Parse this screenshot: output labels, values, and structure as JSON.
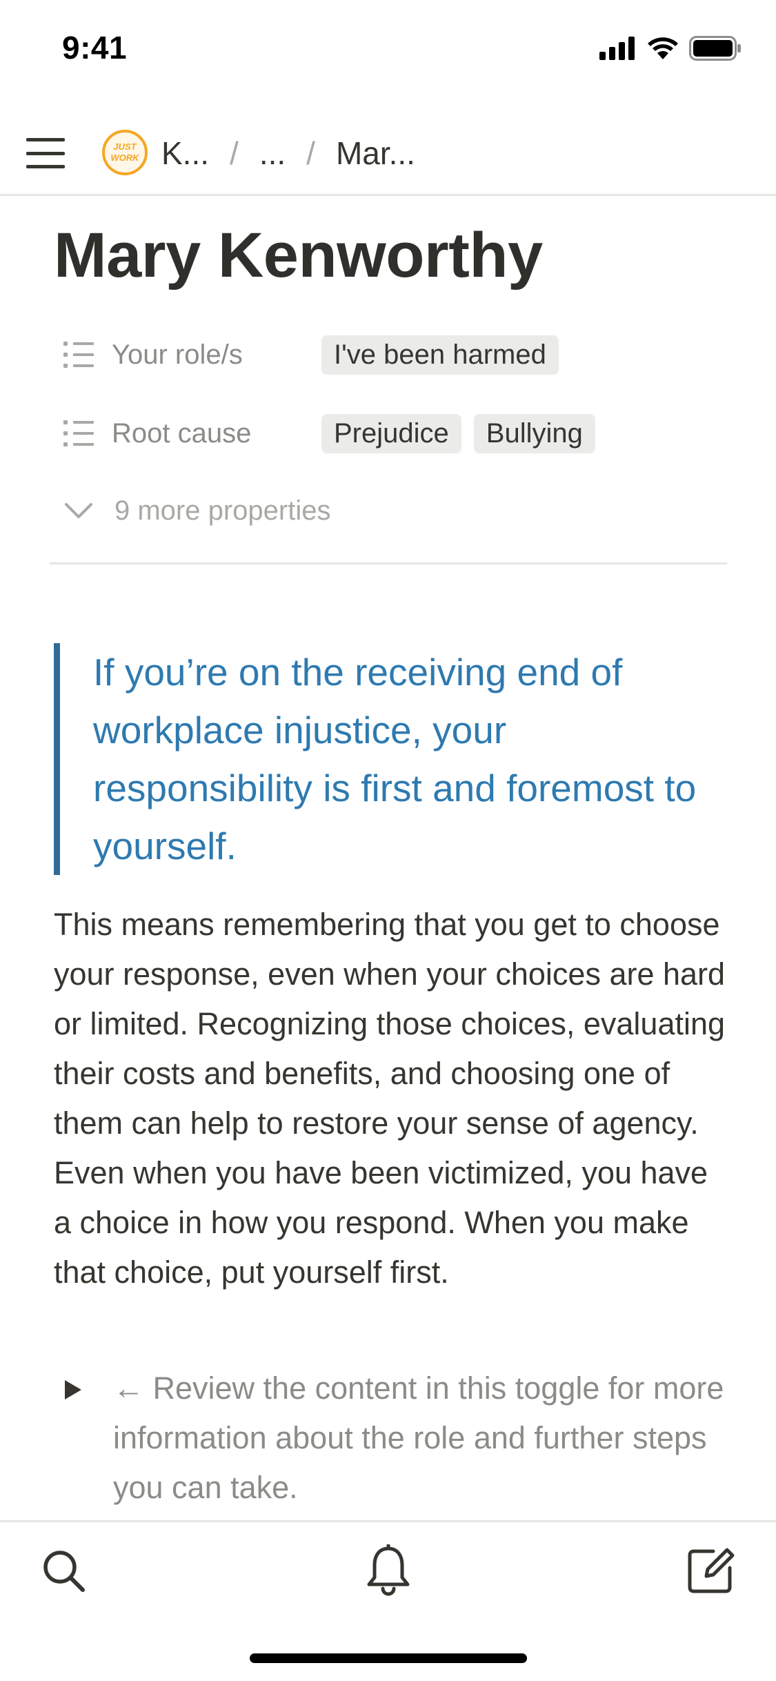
{
  "status_bar": {
    "time": "9:41"
  },
  "header": {
    "workspace_logo_text": "JUST WORK",
    "breadcrumb": [
      "K...",
      "...",
      "Mar..."
    ]
  },
  "page": {
    "title": "Mary Kenworthy",
    "properties": [
      {
        "label": "Your role/s",
        "tags": [
          "I've been harmed"
        ]
      },
      {
        "label": "Root cause",
        "tags": [
          "Prejudice",
          "Bullying"
        ]
      }
    ],
    "more_properties": "9 more properties",
    "quote": "If you’re on the receiving end of workplace injustice, your responsibility is first and foremost to yourself.",
    "paragraph": "This means remembering that you get to choose your response, even when your choices are hard or limited. Recognizing those choices, evaluating their costs and benefits, and choosing one of them can help to restore your sense of agency. Even when you have been victimized, you have a choice in how you respond. When you make that choice, put yourself first.",
    "toggle_text": "← Review the content in this toggle for more information about the role and further steps you can take."
  },
  "colors": {
    "quote_text": "#2e7ab0",
    "quote_bar": "#2e6b99",
    "tag_background": "#ebebea",
    "logo_orange": "#f5a623"
  },
  "tab_bar": {
    "icons": [
      "search-icon",
      "bell-icon",
      "compose-icon"
    ]
  }
}
